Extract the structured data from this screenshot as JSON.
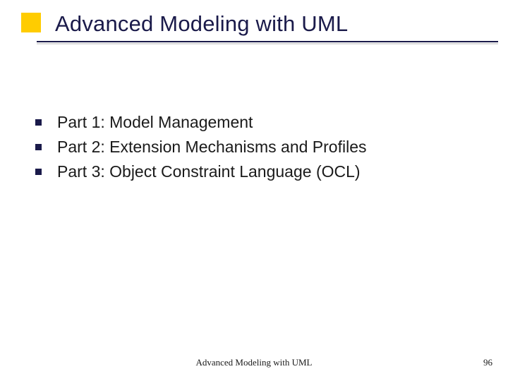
{
  "title": "Advanced Modeling with UML",
  "bullets": [
    "Part 1: Model Management",
    "Part 2: Extension Mechanisms and Profiles",
    "Part 3: Object Constraint Language (OCL)"
  ],
  "footer": {
    "title": "Advanced Modeling with UML",
    "page": "96"
  }
}
